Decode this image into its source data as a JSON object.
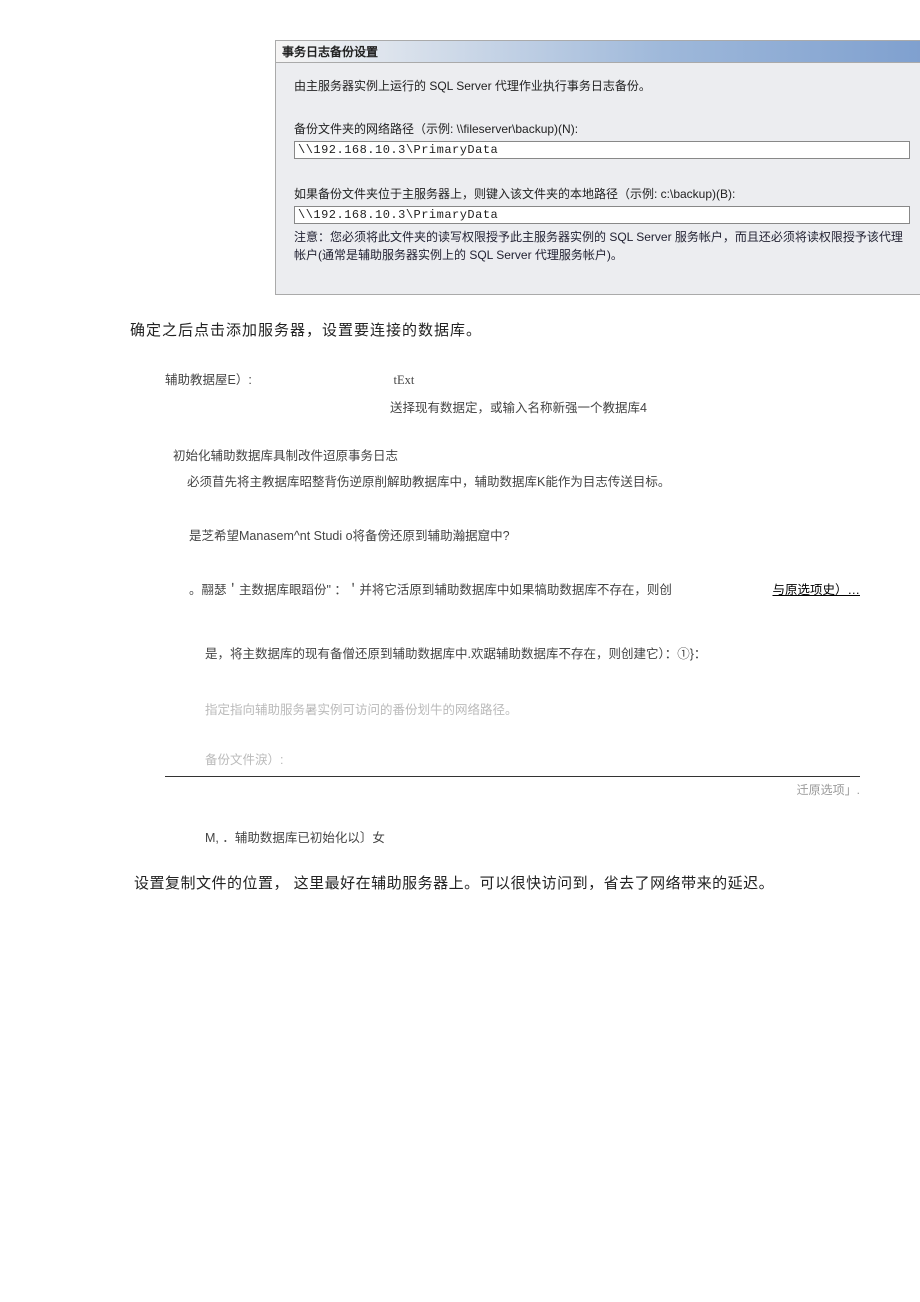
{
  "dialog": {
    "title": "事务日志备份设置",
    "line1": "由主服务器实例上运行的 SQL Server 代理作业执行事务日志备份。",
    "netPathLabel": "备份文件夹的网络路径（示例: \\\\fileserver\\backup)(N):",
    "netPathValue": "\\\\192.168.10.3\\PrimaryData",
    "localPathLabel": "如果备份文件夹位于主服务器上，则键入该文件夹的本地路径（示例: c:\\backup)(B):",
    "localPathValue": "\\\\192.168.10.3\\PrimaryData",
    "note": "注意：您必须将此文件夹的读写权限授予此主服务器实例的 SQL Server 服务帐户，而且还必须将读权限授予该代理帐户(通常是辅助服务器实例上的 SQL Server 代理服务帐户)。"
  },
  "para1": "确定之后点击添加服务器，设置要连接的数据库。",
  "form": {
    "secDbLabel": "辅助教据屋E）:",
    "secDbValue": "tExt",
    "secDbHint": "送择现有数据定，或输入名称新强一个教据库4",
    "initTitle": "初始化辅助数据库具制改件迢原事务日志",
    "initBody": "必须苜先将主教据库昭整背伤逆原削解助教据库中，辅助数据库K能作为目志传送目标。",
    "question": "是芝希望Manasem^nt Studi o将备傍还原到辅助瀚据窟中?",
    "opt1": "。翮瑟＇主数据库眼蹈份\" ：＇并将它活原到辅助数据库中如果犒助数据库不存在，则创",
    "opt1Link": "与原选项史）…",
    "opt2": "是，将主数据库的现有备僧还原到辅助数据库中.欢踞辅助数据库不存在，则创建它）：①}：",
    "pathHint": "指定指向辅助服务暑实例可访问的番份划牛的网络路径。",
    "backupFileLabel": "备份文件淚）:",
    "restoreOpt": "迁原选项」.",
    "inited": "M, ．辅助数据库已初始化以〕女"
  },
  "para2": "设置复制文件的位置，  这里最好在辅助服务器上。可以很快访问到，省去了网络带来的延迟。"
}
